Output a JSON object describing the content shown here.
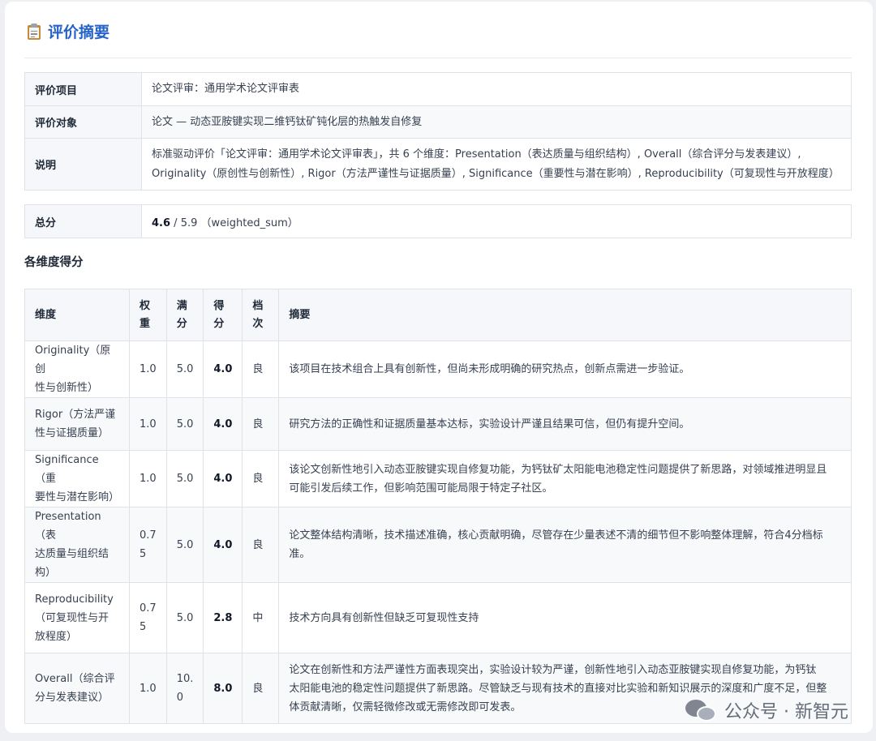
{
  "header": {
    "icon": "clipboard-icon",
    "title": "评价摘要"
  },
  "meta": [
    {
      "key": "评价项目",
      "value": "论文评审：通用学术论文评审表"
    },
    {
      "key": "评价对象",
      "value": "论文 — 动态亚胺键实现二维钙钛矿钝化层的热触发自修复"
    },
    {
      "key": "说明",
      "value_line1": "标准驱动评价「论文评审：通用学术论文评审表」，共 6 个维度：Presentation（表达质量与组织结构）, Overall（综合评分与发表建议）,",
      "value_line2": "Originality（原创性与创新性）, Rigor（方法严谨性与证据质量）, Significance（重要性与潜在影响）, Reproducibility（可复现性与开放程度）"
    }
  ],
  "total": {
    "key": "总分",
    "score": "4.6",
    "sep": " / ",
    "max": "5.9",
    "method": "（weighted_sum）"
  },
  "section_title": "各维度得分",
  "columns": [
    "维度",
    "权\n重",
    "满\n分",
    "得\n分",
    "档\n次",
    "摘要"
  ],
  "columns_split": [
    [
      "维度"
    ],
    [
      "权",
      "重"
    ],
    [
      "满",
      "分"
    ],
    [
      "得",
      "分"
    ],
    [
      "档",
      "次"
    ],
    [
      "摘要"
    ]
  ],
  "rows": [
    {
      "name": [
        "Originality（原创",
        "性与创新性）"
      ],
      "weight": [
        "1.0"
      ],
      "full": [
        "5.0"
      ],
      "score": "4.0",
      "grade": "良",
      "summary": [
        "该项目在技术组合上具有创新性，但尚未形成明确的研究热点，创新点需进一步验证。"
      ]
    },
    {
      "name": [
        "Rigor（方法严谨",
        "性与证据质量）"
      ],
      "weight": [
        "1.0"
      ],
      "full": [
        "5.0"
      ],
      "score": "4.0",
      "grade": "良",
      "summary": [
        "研究方法的正确性和证据质量基本达标，实验设计严谨且结果可信，但仍有提升空间。"
      ]
    },
    {
      "name": [
        "Significance（重",
        "要性与潜在影响）"
      ],
      "weight": [
        "1.0"
      ],
      "full": [
        "5.0"
      ],
      "score": "4.0",
      "grade": "良",
      "summary": [
        "该论文创新性地引入动态亚胺键实现自修复功能，为钙钛矿太阳能电池稳定性问题提供了新思路，对领域推进明显且",
        "可能引发后续工作，但影响范围可能局限于特定子社区。"
      ]
    },
    {
      "name": [
        "Presentation（表",
        "达质量与组织结",
        "构）"
      ],
      "weight": [
        "0.7",
        "5"
      ],
      "full": [
        "5.0"
      ],
      "score": "4.0",
      "grade": "良",
      "summary": [
        "论文整体结构清晰，技术描述准确，核心贡献明确，尽管存在少量表述不清的细节但不影响整体理解，符合4分档标",
        "准。"
      ]
    },
    {
      "name": [
        "Reproducibility",
        "（可复现性与开",
        "放程度）"
      ],
      "weight": [
        "0.7",
        "5"
      ],
      "full": [
        "5.0"
      ],
      "score": "2.8",
      "grade": "中",
      "summary": [
        "技术方向具有创新性但缺乏可复现性支持"
      ]
    },
    {
      "name": [
        "Overall（综合评",
        "分与发表建议）"
      ],
      "weight": [
        "1.0"
      ],
      "full": [
        "10.",
        "0"
      ],
      "score": "8.0",
      "grade": "良",
      "summary": [
        "论文在创新性和方法严谨性方面表现突出，实验设计较为严谨，创新性地引入动态亚胺键实现自修复功能，为钙钛",
        "太阳能电池的稳定性问题提供了新思路。尽管缺乏与现有技术的直接对比实验和新知识展示的深度和广度不足，但整",
        "体贡献清晰，仅需轻微修改或无需修改即可发表。"
      ]
    }
  ],
  "watermark": {
    "icon": "wechat-icon",
    "text": "公众号 · 新智元"
  }
}
